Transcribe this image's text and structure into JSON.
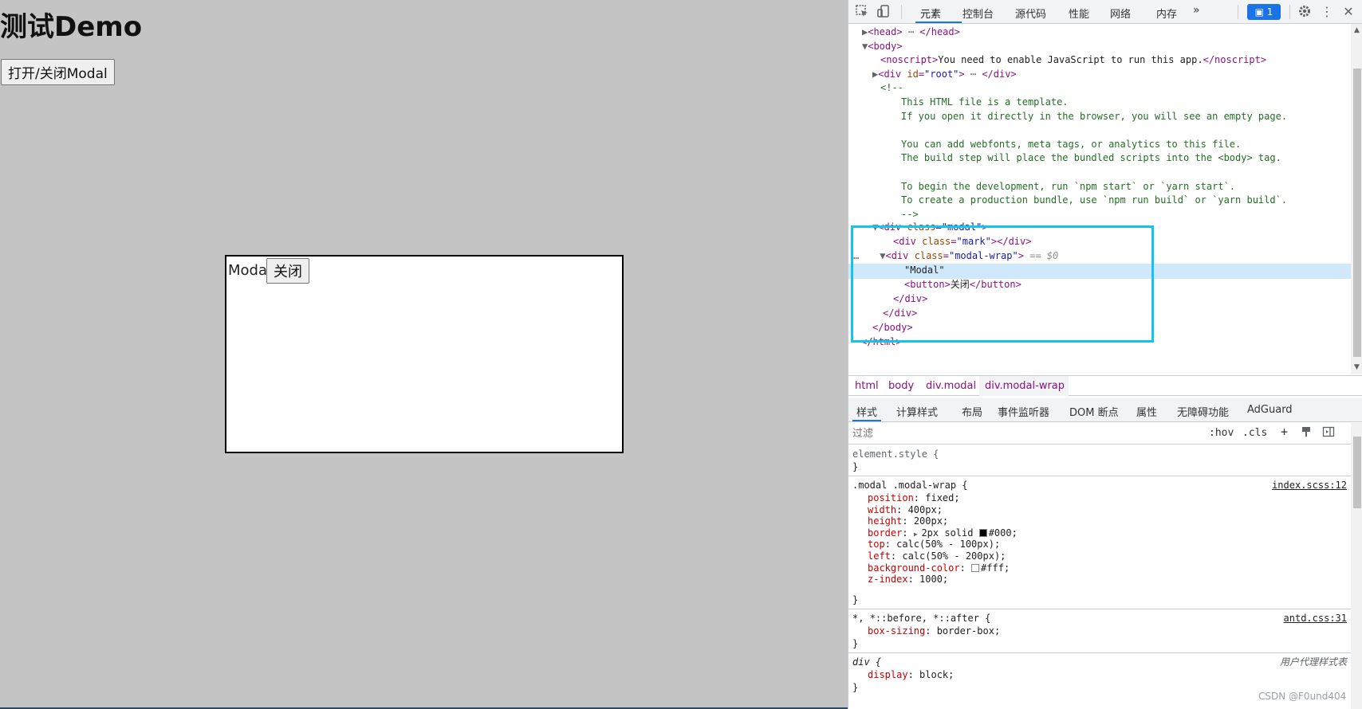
{
  "page": {
    "title": "测试Demo",
    "toggle_button": "打开/关闭Modal",
    "modal_text": "Modal",
    "close_button": "关闭"
  },
  "devtools": {
    "tabs": [
      "元素",
      "控制台",
      "源代码",
      "性能",
      "网络",
      "内存"
    ],
    "more_tabs_icon": "»",
    "issues_badge": "1",
    "dom_lines": [
      {
        "indent": 1,
        "tri": "▶",
        "html": "<head>",
        "ell": true,
        "close": "</head>"
      },
      {
        "indent": 1,
        "tri": "▼",
        "html": "<body>"
      },
      {
        "indent": 2,
        "tri": "",
        "noscript": "<noscript>",
        "text": "You need to enable JavaScript to run this app.",
        "close": "</noscript>"
      },
      {
        "indent": 2,
        "tri": "▶",
        "div_root": true
      },
      {
        "indent": 2,
        "tri": "",
        "comment": "<!--"
      },
      {
        "indent": 4,
        "tri": "",
        "comment": "This HTML file is a template."
      },
      {
        "indent": 4,
        "tri": "",
        "comment": "If you open it directly in the browser, you will see an empty page."
      },
      {
        "indent": 4,
        "tri": "",
        "comment": ""
      },
      {
        "indent": 4,
        "tri": "",
        "comment": "You can add webfonts, meta tags, or analytics to this file."
      },
      {
        "indent": 4,
        "tri": "",
        "comment": "The build step will place the bundled scripts into the <body> tag."
      },
      {
        "indent": 4,
        "tri": "",
        "comment": ""
      },
      {
        "indent": 4,
        "tri": "",
        "comment": "To begin the development, run `npm start` or `yarn start`."
      },
      {
        "indent": 4,
        "tri": "",
        "comment": "To create a production bundle, use `npm run build` or `yarn build`."
      },
      {
        "indent": 4,
        "tri": "",
        "comment": "-->"
      }
    ],
    "modal_div": {
      "tag": "div",
      "attr": "class",
      "val": "\"modal\""
    },
    "mark_div": {
      "tag": "div",
      "attr": "class",
      "val": "\"mark\""
    },
    "wrap_div": {
      "tag": "div",
      "attr": "class",
      "val": "\"modal-wrap\"",
      "marker": "== $0"
    },
    "wrap_text": "\"Modal\"",
    "wrap_button": {
      "open": "<button>",
      "text": "关闭",
      "close": "</button>"
    },
    "close_div": "</div>",
    "close_body": "</body>",
    "close_html": "</html>",
    "breadcrumb": [
      "html",
      "body",
      "div.modal",
      "div.modal-wrap"
    ],
    "style_tabs": [
      "样式",
      "计算样式",
      "布局",
      "事件监听器",
      "DOM 断点",
      "属性",
      "无障碍功能",
      "AdGuard"
    ],
    "filter_placeholder": "过滤",
    "filter_buttons": [
      ":hov",
      ".cls",
      "+"
    ],
    "rules": {
      "element_style": "element.style {",
      "close_brace": "}",
      "r1_selector": ".modal .modal-wrap {",
      "r1_source": "index.scss:12",
      "r1_props": [
        {
          "name": "position",
          "value": "fixed;"
        },
        {
          "name": "width",
          "value": "400px;"
        },
        {
          "name": "height",
          "value": "200px;"
        },
        {
          "name": "border",
          "value": "2px solid ",
          "swatch": "#000000",
          "value2": "#000;"
        },
        {
          "name": "top",
          "value": "calc(50% - 100px);"
        },
        {
          "name": "left",
          "value": "calc(50% - 200px);"
        },
        {
          "name": "background-color",
          "value": "",
          "swatch": "#ffffff",
          "value2": "#fff;"
        },
        {
          "name": "z-index",
          "value": "1000;"
        }
      ],
      "r2_selector": "*, *::before, *::after {",
      "r2_source": "antd.css:31",
      "r2_props": [
        {
          "name": "box-sizing",
          "value": "border-box;"
        }
      ],
      "r3_selector": "div {",
      "r3_source": "用户代理样式表",
      "r3_props": [
        {
          "name": "display",
          "value": "block;"
        }
      ]
    },
    "watermark": "CSDN @F0und404"
  },
  "colors": {
    "page_bg": "#c4c4c4",
    "highlight_box": "#12c4f3",
    "selected_row": "#cfe8fc",
    "accent": "#1a73e8"
  }
}
